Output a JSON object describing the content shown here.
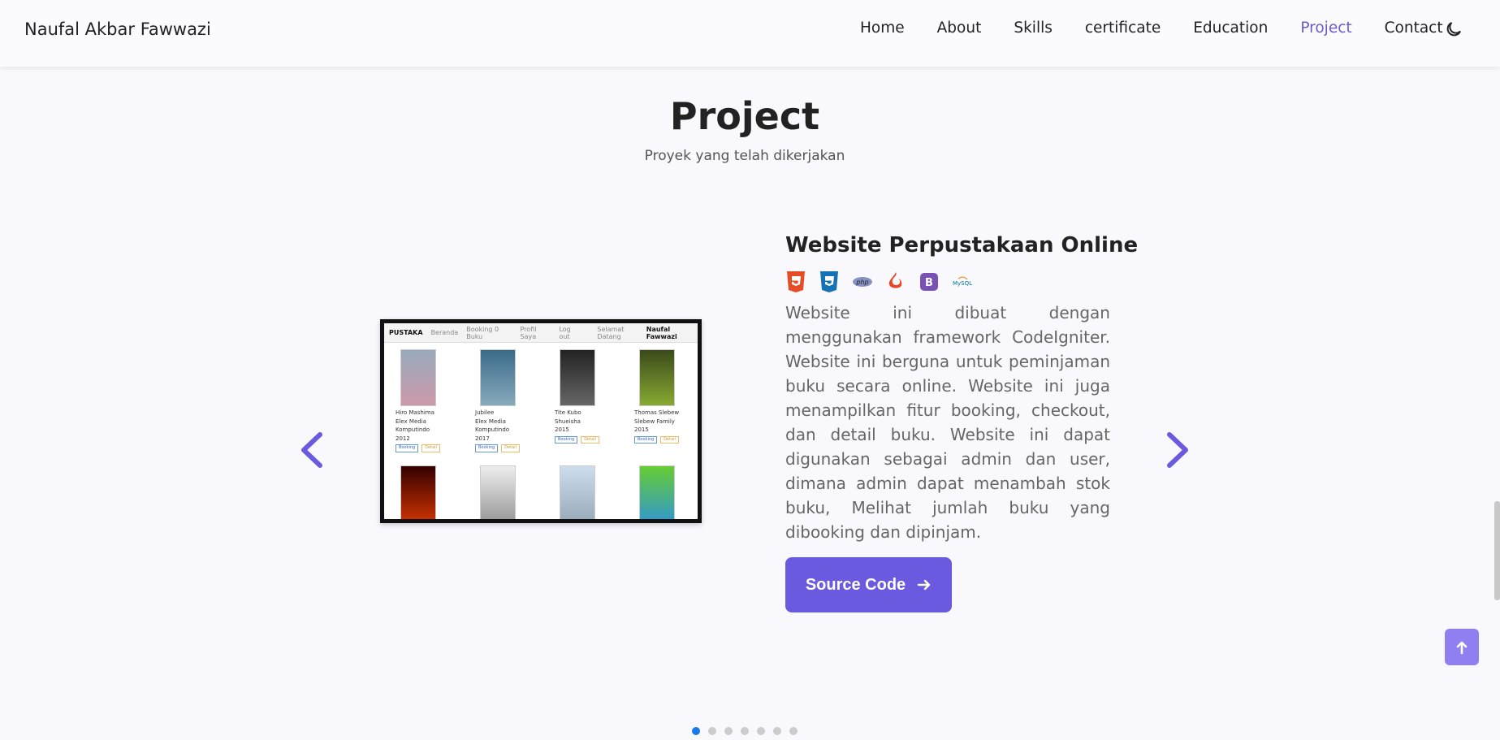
{
  "header": {
    "brand": "Naufal Akbar Fawwazi",
    "nav": [
      "Home",
      "About",
      "Skills",
      "certificate",
      "Education",
      "Project",
      "Contact"
    ],
    "active_nav": "Project",
    "theme_icon": "moon-icon"
  },
  "section": {
    "title": "Project",
    "subtitle": "Proyek yang telah dikerjakan"
  },
  "project": {
    "title": "Website Perpustakaan Online",
    "tech_icons": [
      "html5-icon",
      "css3-icon",
      "php-icon",
      "codeigniter-icon",
      "bootstrap-icon",
      "mysql-icon"
    ],
    "description": "Website ini dibuat dengan menggunakan framework CodeIgniter. Website ini berguna untuk peminjaman buku secara online. Website ini juga menampilkan fitur booking, checkout, dan detail buku. Website ini dapat digunakan sebagai admin dan user, dimana admin dapat menambah stok buku, Melihat jumlah buku yang dibooking dan dipinjam.",
    "button_label": "Source Code",
    "screenshot": {
      "nav": [
        "PUSTAKA",
        "Beranda",
        "Booking 0 Buku",
        "Profil Saya",
        "Log out",
        "Selamat Datang",
        "Naufal Fawwazi"
      ],
      "books": [
        {
          "author": "Hiro Mashima",
          "publisher": "Elex Media Komputindo",
          "year": "2012"
        },
        {
          "author": "Jubilee",
          "publisher": "Elex Media Komputindo",
          "year": "2017"
        },
        {
          "author": "Tite Kubo",
          "publisher": "Shueisha",
          "year": "2015"
        },
        {
          "author": "Thomas Slebew",
          "publisher": "Slebew Family",
          "year": "2015"
        }
      ],
      "btn_booking": "Booking",
      "btn_detail": "Detail"
    }
  },
  "carousel": {
    "total": 7,
    "active": 0
  },
  "colors": {
    "accent": "#6a5ae0",
    "active_dot": "#1a7be6"
  }
}
